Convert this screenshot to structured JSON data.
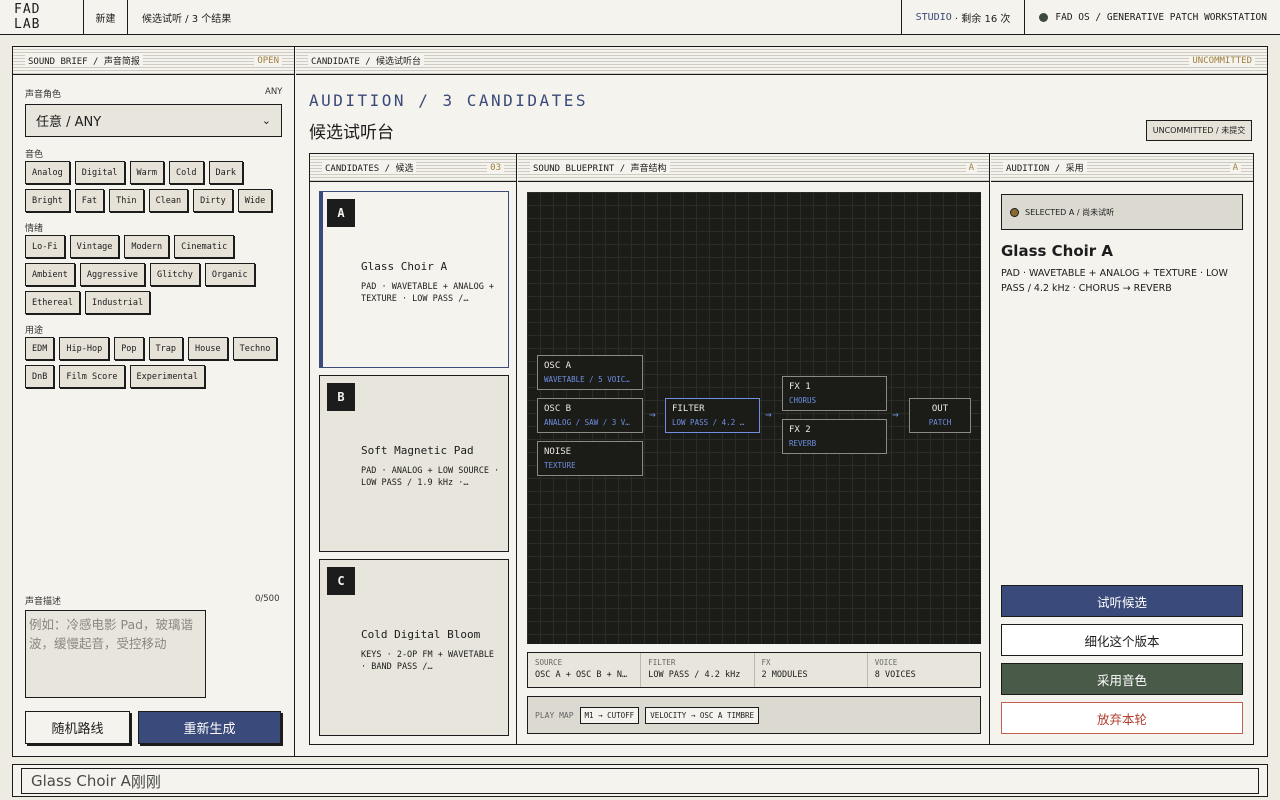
{
  "topbar": {
    "logo": "FAD LAB",
    "new_label": "新建",
    "breadcrumb": "候选试听 / 3 个结果",
    "studio": "STUDIO",
    "remaining": " · 剩余 16 次",
    "os_label": "FAD OS / GENERATIVE PATCH WORKSTATION"
  },
  "brief": {
    "header_en": "SOUND BRIEF",
    "header_sep": " / ",
    "header_cn": "声音简报",
    "header_status": "OPEN",
    "role_label": "声音角色",
    "role_value_tag": "ANY",
    "role_selected": "任意 / ANY",
    "timbre_label": "音色",
    "timbre": [
      "Analog",
      "Digital",
      "Warm",
      "Cold",
      "Dark",
      "Bright",
      "Fat",
      "Thin",
      "Clean",
      "Dirty",
      "Wide"
    ],
    "mood_label": "情绪",
    "mood": [
      "Lo-Fi",
      "Vintage",
      "Modern",
      "Cinematic",
      "Ambient",
      "Aggressive",
      "Glitchy",
      "Organic",
      "Ethereal",
      "Industrial"
    ],
    "use_label": "用途",
    "use": [
      "EDM",
      "Hip-Hop",
      "Pop",
      "Trap",
      "House",
      "Techno",
      "DnB",
      "Film Score",
      "Experimental"
    ],
    "desc_label": "声音描述",
    "desc_count": "0/500",
    "desc_placeholder": "例如：冷感电影 Pad，玻璃谐波，缓慢起音，受控移动",
    "random_label": "随机路线",
    "regen_label": "重新生成"
  },
  "candidate_panel": {
    "header_en": "CANDIDATE",
    "header_cn": "候选试听台",
    "header_status": "UNCOMMITTED",
    "title_en": "AUDITION / 3 CANDIDATES",
    "title_cn": "候选试听台",
    "state_tag": "UNCOMMITTED / 未提交"
  },
  "candidates": {
    "header_en": "CANDIDATES",
    "header_cn": "候选",
    "count": "03",
    "items": [
      {
        "letter": "A",
        "name": "Glass Choir A",
        "desc": "PAD · WAVETABLE + ANALOG + TEXTURE · LOW PASS /…"
      },
      {
        "letter": "B",
        "name": "Soft Magnetic Pad",
        "desc": "PAD · ANALOG + LOW SOURCE · LOW PASS / 1.9 kHz ·…"
      },
      {
        "letter": "C",
        "name": "Cold Digital Bloom",
        "desc": "KEYS · 2-OP FM + WAVETABLE · BAND PASS /…"
      }
    ]
  },
  "blueprint": {
    "header_en": "SOUND BLUEPRINT",
    "header_cn": "声音结构",
    "tag": "A",
    "nodes": {
      "osc_a": {
        "title": "OSC A",
        "sub": "WAVETABLE / 5 VOIC…"
      },
      "osc_b": {
        "title": "OSC B",
        "sub": "ANALOG / SAW / 3 V…"
      },
      "noise": {
        "title": "NOISE",
        "sub": "TEXTURE"
      },
      "filter": {
        "title": "FILTER",
        "sub": "LOW PASS / 4.2 …"
      },
      "fx1": {
        "title": "FX 1",
        "sub": "CHORUS"
      },
      "fx2": {
        "title": "FX 2",
        "sub": "REVERB"
      },
      "out": {
        "title": "OUT",
        "sub": "PATCH"
      }
    },
    "stats": [
      {
        "k": "SOURCE",
        "v": "OSC A + OSC B + N…"
      },
      {
        "k": "FILTER",
        "v": "LOW PASS / 4.2 kHz"
      },
      {
        "k": "FX",
        "v": "2 MODULES"
      },
      {
        "k": "VOICE",
        "v": "8 VOICES"
      }
    ],
    "playmap_label": "PLAY MAP",
    "playmap": [
      "M1 → CUTOFF",
      "VELOCITY → OSC A TIMBRE"
    ]
  },
  "audition": {
    "header_en": "AUDITION",
    "header_cn": "采用",
    "tag": "A",
    "selected": "SELECTED A / 尚未试听",
    "name": "Glass Choir A",
    "desc": "PAD · WAVETABLE + ANALOG + TEXTURE · LOW PASS / 4.2 kHz · CHORUS → REVERB",
    "btn_listen": "试听候选",
    "btn_refine": "细化这个版本",
    "btn_adopt": "采用音色",
    "btn_discard": "放弃本轮"
  },
  "statusbar": {
    "name": "Glass Choir A",
    "time": "刚刚"
  }
}
